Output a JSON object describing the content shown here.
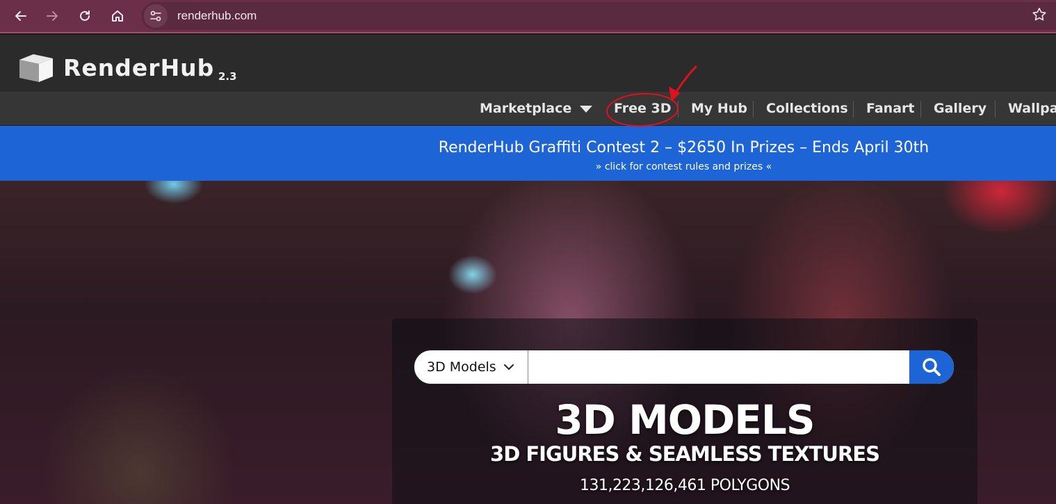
{
  "browser": {
    "url": "renderhub.com",
    "icons": [
      "back-arrow-icon",
      "forward-arrow-icon",
      "reload-icon",
      "home-icon",
      "site-info-icon",
      "bookmark-star-icon"
    ],
    "chrome_color": "#6b2f49"
  },
  "site": {
    "logo_text": "RenderHub",
    "version": "2.3"
  },
  "nav": {
    "items": [
      {
        "label": "Marketplace",
        "has_dropdown": true
      },
      {
        "label": "Free 3D",
        "highlighted_by_annotation": true
      },
      {
        "label": "My Hub"
      },
      {
        "label": "Collections"
      },
      {
        "label": "Fanart"
      },
      {
        "label": "Gallery"
      },
      {
        "label": "Wallpap"
      }
    ]
  },
  "banner": {
    "title": "RenderHub Graffiti Contest 2 – $2650 In Prizes – Ends April 30th",
    "subtitle": "»  click for contest rules and prizes  «",
    "color": "#1d64d6"
  },
  "search": {
    "category_selected": "3D Models",
    "input_value": "",
    "button_color": "#1d64d6"
  },
  "hero": {
    "title": "3D MODELS",
    "subtitle": "3D FIGURES & SEAMLESS TEXTURES",
    "stat": "131,223,126,461 POLYGONS"
  },
  "annotation": {
    "color": "#e0101e"
  }
}
